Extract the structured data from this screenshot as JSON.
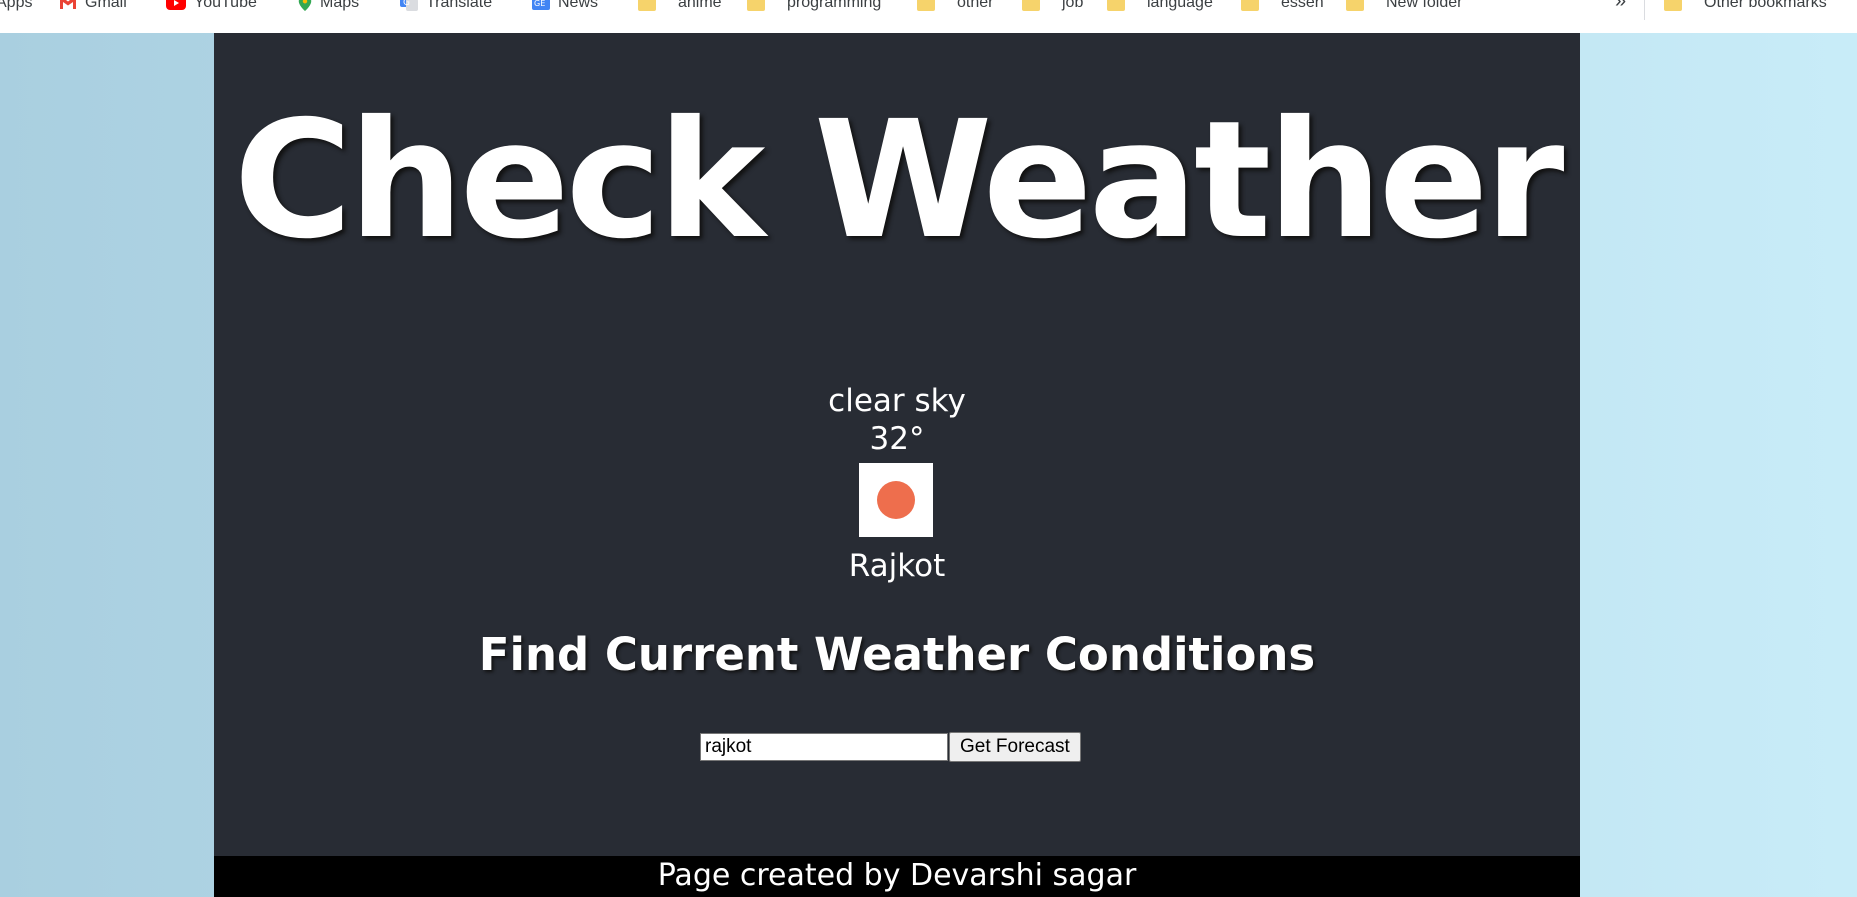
{
  "bookmarks": {
    "items": [
      {
        "label": "Apps",
        "icon": "apps-icon"
      },
      {
        "label": "Gmail",
        "icon": "gmail-icon"
      },
      {
        "label": "YouTube",
        "icon": "youtube-icon"
      },
      {
        "label": "Maps",
        "icon": "maps-icon"
      },
      {
        "label": "Translate",
        "icon": "translate-icon"
      },
      {
        "label": "News",
        "icon": "news-icon"
      },
      {
        "label": "anime",
        "icon": "folder-icon"
      },
      {
        "label": "programming",
        "icon": "folder-icon"
      },
      {
        "label": "other",
        "icon": "folder-icon"
      },
      {
        "label": "job",
        "icon": "folder-icon"
      },
      {
        "label": "language",
        "icon": "folder-icon"
      },
      {
        "label": "essen",
        "icon": "folder-icon"
      },
      {
        "label": "New folder",
        "icon": "folder-icon"
      }
    ],
    "overflow": "»",
    "other": "Other bookmarks"
  },
  "page": {
    "title": "Check Weather",
    "weather": {
      "description": "clear sky",
      "temperature": "32°",
      "city": "Rajkot",
      "icon": "sun-icon"
    },
    "subtitle": "Find Current Weather Conditions",
    "search": {
      "value": "rajkot",
      "button": "Get Forecast"
    },
    "footer": "Page created by Devarshi sagar"
  },
  "colors": {
    "panel": "#282c34",
    "footer": "#000000",
    "sun": "#ee6e4d",
    "background": "#bde0ee"
  }
}
